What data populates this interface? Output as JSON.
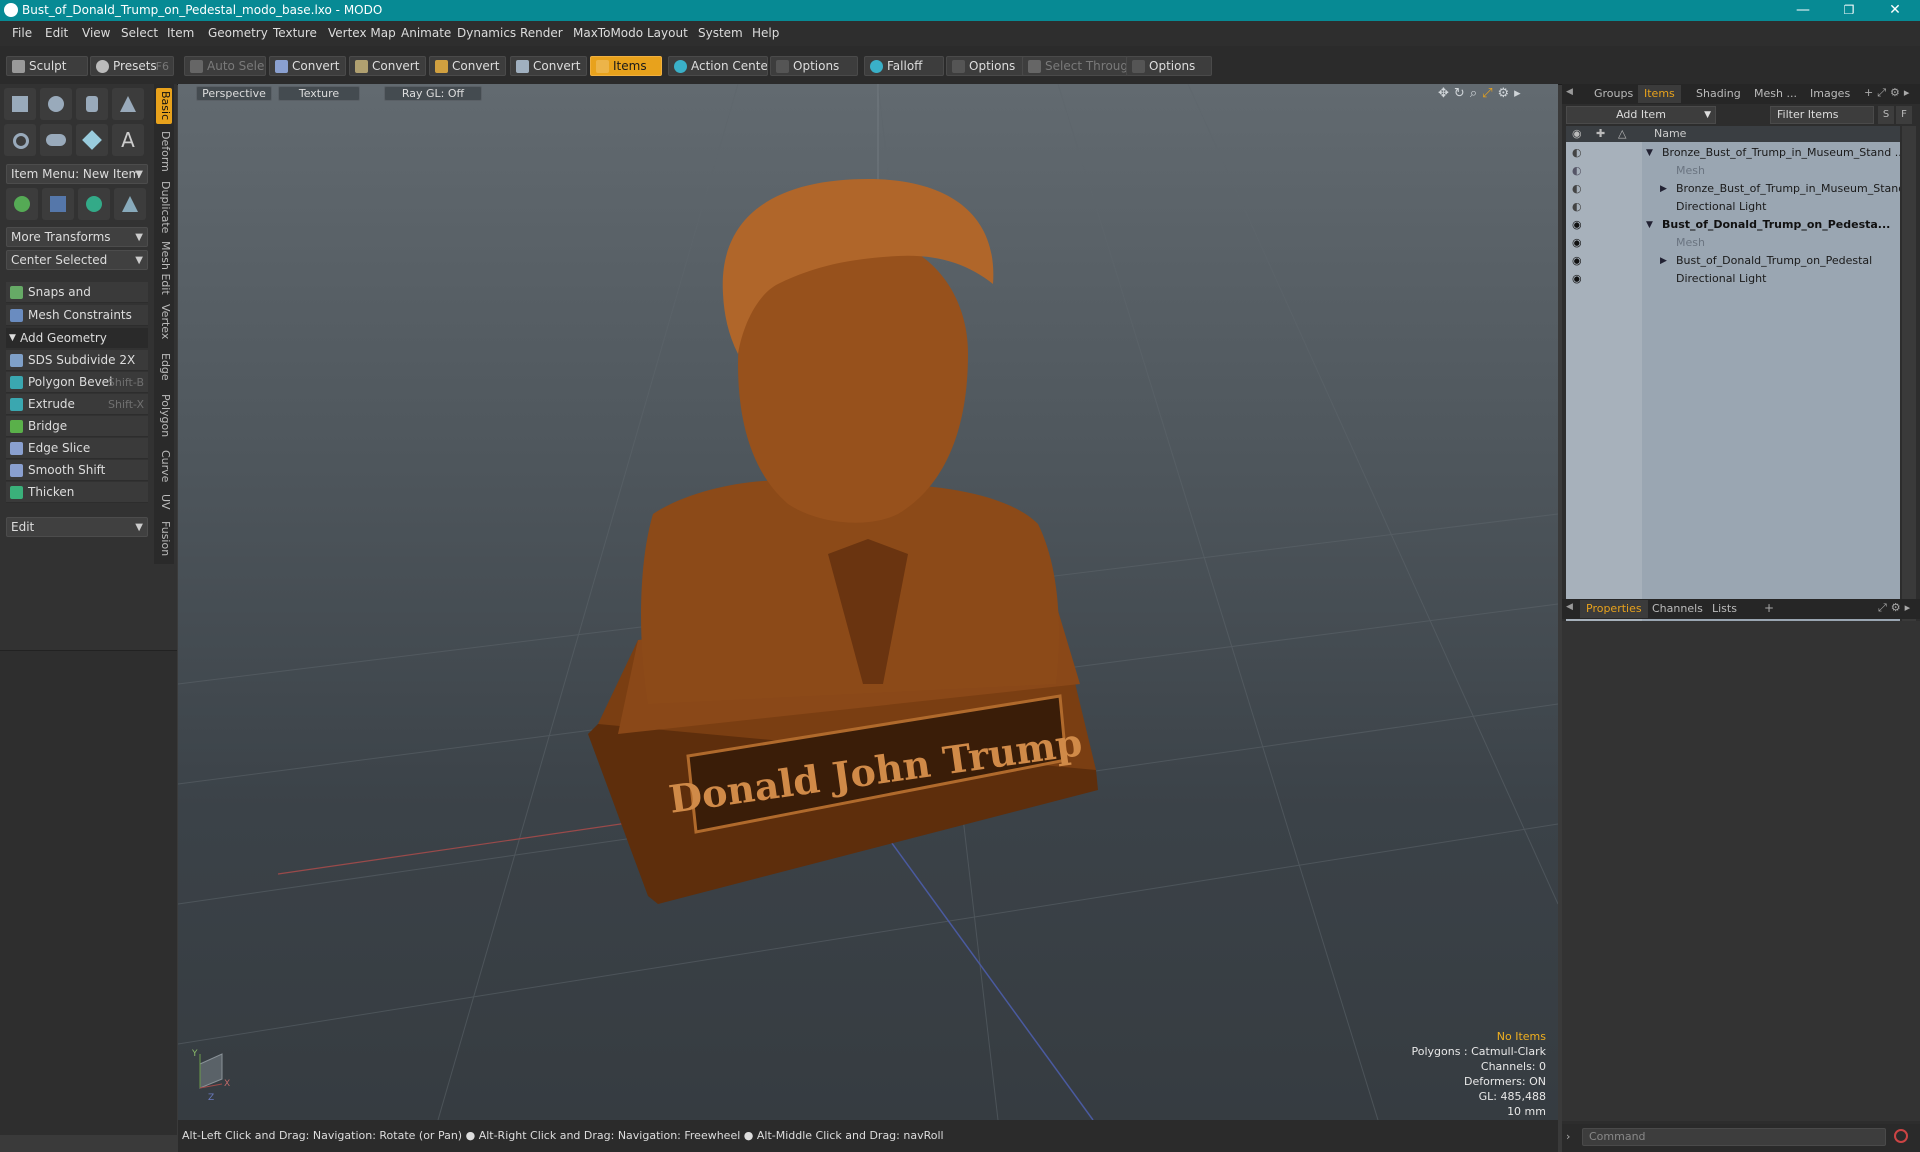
{
  "window": {
    "title": "Bust_of_Donald_Trump_on_Pedestal_modo_base.lxo - MODO",
    "min": "—",
    "max": "❐",
    "close": "✕"
  },
  "menu": [
    "File",
    "Edit",
    "View",
    "Select",
    "Item",
    "Geometry",
    "Texture",
    "Vertex Map",
    "Animate",
    "Dynamics",
    "Render",
    "MaxToModo",
    "Layout",
    "System",
    "Help"
  ],
  "toolbar": {
    "sculpt": "Sculpt",
    "presets": "Presets",
    "presets_key": "F6",
    "auto_select": "Auto Select",
    "convert1": "Convert",
    "convert2": "Convert",
    "convert3": "Convert",
    "convert4": "Convert",
    "items": "Items",
    "action_center": "Action Center",
    "options1": "Options",
    "falloff": "Falloff",
    "options2": "Options",
    "select_through": "Select Through",
    "options3": "Options"
  },
  "left_tabs": [
    "Basic",
    "Deform",
    "Duplicate",
    "Mesh Edit",
    "Vertex",
    "Edge",
    "Polygon",
    "Curve",
    "UV",
    "Fusion"
  ],
  "left": {
    "item_menu": "Item Menu: New Item",
    "more_transforms": "More Transforms",
    "center_selected": "Center Selected",
    "snaps": "Snaps and Precision",
    "mesh_constraints": "Mesh Constraints",
    "add_geometry": "Add Geometry",
    "tools": [
      {
        "label": "SDS Subdivide 2X",
        "shortcut": "",
        "color": "#7fa0c8"
      },
      {
        "label": "Polygon Bevel",
        "shortcut": "Shift-B",
        "color": "#3aa7b0"
      },
      {
        "label": "Extrude",
        "shortcut": "Shift-X",
        "color": "#3aa7b0"
      },
      {
        "label": "Bridge",
        "shortcut": "",
        "color": "#5ab04a"
      },
      {
        "label": "Edge Slice",
        "shortcut": "",
        "color": "#8aa0d0"
      },
      {
        "label": "Smooth Shift",
        "shortcut": "",
        "color": "#8aa0d0"
      },
      {
        "label": "Thicken",
        "shortcut": "",
        "color": "#3ab07a"
      }
    ],
    "edit": "Edit"
  },
  "viewport": {
    "tab_perspective": "Perspective",
    "tab_texture": "Texture",
    "tab_raygl": "Ray GL: Off",
    "plaque_text": "Donald John Trump",
    "info": {
      "no_items": "No Items",
      "polygons": "Polygons : Catmull-Clark",
      "channels": "Channels: 0",
      "deformers": "Deformers: ON",
      "gl": "GL: 485,488",
      "scale": "10 mm"
    },
    "axis_y": "Y",
    "axis_x": "X",
    "axis_z": "Z"
  },
  "status": "Alt-Left Click and Drag: Navigation: Rotate (or Pan) ● Alt-Right Click and Drag: Navigation: Freewheel ● Alt-Middle Click and Drag: navRoll",
  "items_panel": {
    "tabs": [
      "Groups",
      "Items",
      "Shading",
      "Mesh ...",
      "Images"
    ],
    "add_item": "Add Item",
    "filter": "Filter Items",
    "s_btn": "S",
    "f_btn": "F",
    "col_name": "Name",
    "tree": [
      {
        "label": "Bronze_Bust_of_Trump_in_Museum_Stand ...",
        "indent": 0,
        "dim": false,
        "bold": false,
        "expand": "▼"
      },
      {
        "label": "Mesh",
        "indent": 1,
        "dim": true,
        "bold": false,
        "expand": ""
      },
      {
        "label": "Bronze_Bust_of_Trump_in_Museum_Stand",
        "indent": 1,
        "dim": false,
        "bold": false,
        "expand": "▶"
      },
      {
        "label": "Directional Light",
        "indent": 1,
        "dim": false,
        "bold": false,
        "expand": ""
      },
      {
        "label": "Bust_of_Donald_Trump_on_Pedesta...",
        "indent": 0,
        "dim": false,
        "bold": true,
        "expand": "▼"
      },
      {
        "label": "Mesh",
        "indent": 1,
        "dim": true,
        "bold": false,
        "expand": ""
      },
      {
        "label": "Bust_of_Donald_Trump_on_Pedestal",
        "indent": 1,
        "dim": false,
        "bold": false,
        "expand": "▶"
      },
      {
        "label": "Directional Light",
        "indent": 1,
        "dim": false,
        "bold": false,
        "expand": ""
      }
    ]
  },
  "props_panel": {
    "tabs": [
      "Properties",
      "Channels",
      "Lists"
    ],
    "command_placeholder": "Command"
  }
}
